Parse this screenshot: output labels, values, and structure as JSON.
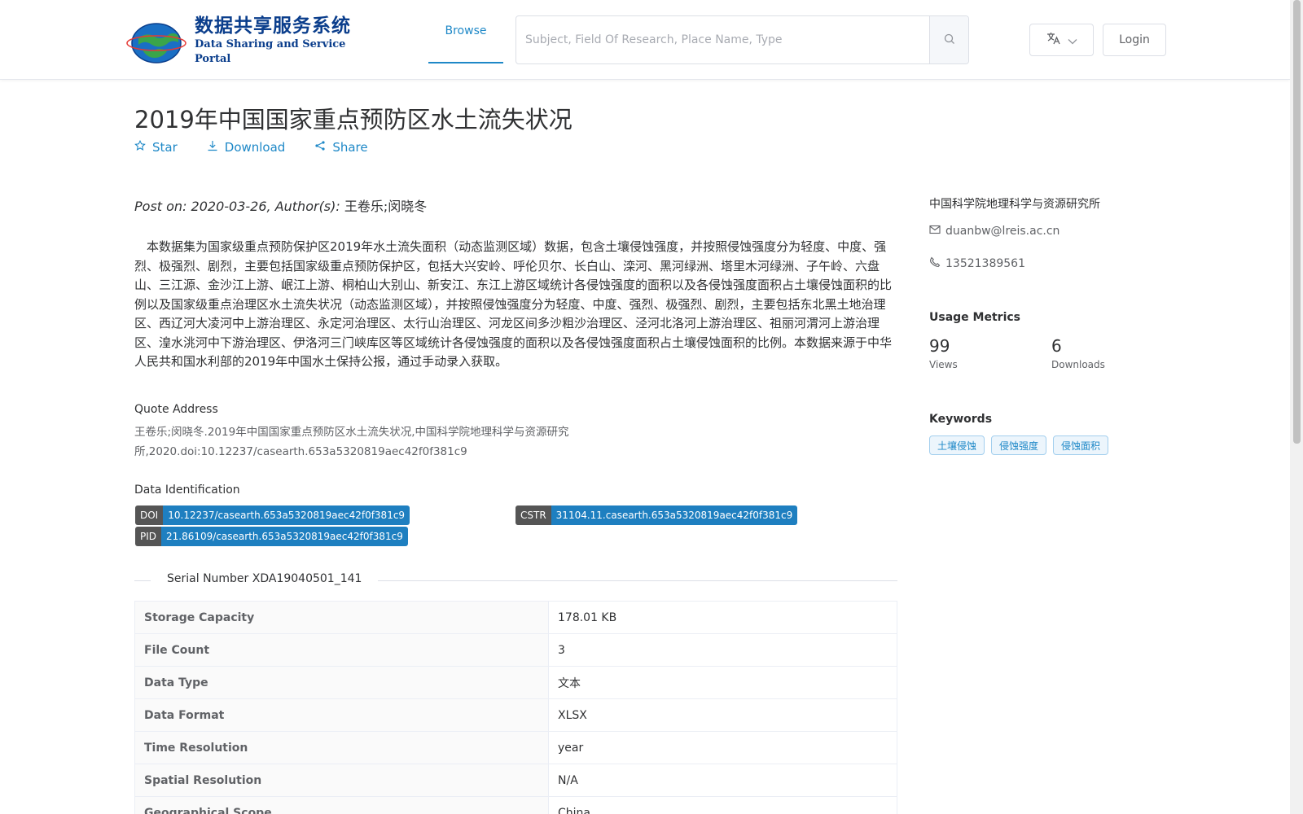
{
  "header": {
    "logo_cn": "数据共享服务系统",
    "logo_en": "Data Sharing and Service Portal",
    "nav_browse": "Browse",
    "search_placeholder": "Subject, Field Of Research, Place Name, Type",
    "login": "Login"
  },
  "dataset": {
    "title": "2019年中国国家重点预防区水土流失状况",
    "actions": {
      "star": "Star",
      "download": "Download",
      "share": "Share"
    },
    "post_on_label": "Post on: 2020-03-26, Author(s): ",
    "authors": "王卷乐;闵晓冬",
    "description": "本数据集为国家级重点预防保护区2019年水土流失面积（动态监测区域）数据，包含土壤侵蚀强度，并按照侵蚀强度分为轻度、中度、强烈、极强烈、剧烈，主要包括国家级重点预防保护区，包括大兴安岭、呼伦贝尔、长白山、滦河、黑河绿洲、塔里木河绿洲、子午岭、六盘山、三江源、金沙江上游、岷江上游、桐柏山大别山、新安江、东江上游区域统计各侵蚀强度的面积以及各侵蚀强度面积占土壤侵蚀面积的比例以及国家级重点治理区水土流失状况（动态监测区域），并按照侵蚀强度分为轻度、中度、强烈、极强烈、剧烈，主要包括东北黑土地治理区、西辽河大凌河中上游治理区、永定河治理区、太行山治理区、河龙区间多沙粗沙治理区、泾河北洛河上游治理区、祖丽河渭河上游治理区、湟水洮河中下游治理区、伊洛河三门峡库区等区域统计各侵蚀强度的面积以及各侵蚀强度面积占土壤侵蚀面积的比例。本数据来源于中华人民共和国水利部的2019年中国水土保持公报，通过手动录入获取。",
    "quote_label": "Quote Address",
    "quote_text": "王卷乐;闵晓冬.2019年中国国家重点预防区水土流失状况,中国科学院地理科学与资源研究所,2020.doi:10.12237/casearth.653a5320819aec42f0f381c9",
    "identification_label": "Data Identification",
    "ids": {
      "doi_key": "DOI",
      "doi_val": "10.12237/casearth.653a5320819aec42f0f381c9",
      "cstr_key": "CSTR",
      "cstr_val": "31104.11.casearth.653a5320819aec42f0f381c9",
      "pid_key": "PID",
      "pid_val": "21.86109/casearth.653a5320819aec42f0f381c9"
    },
    "serial_number": "Serial Number XDA19040501_141",
    "info": [
      {
        "k": "Storage Capacity",
        "v": "178.01 KB"
      },
      {
        "k": "File Count",
        "v": "3"
      },
      {
        "k": "Data Type",
        "v": "文本"
      },
      {
        "k": "Data Format",
        "v": "XLSX"
      },
      {
        "k": "Time Resolution",
        "v": "year"
      },
      {
        "k": "Spatial Resolution",
        "v": "N/A"
      },
      {
        "k": "Geographical Scope",
        "v": "China"
      }
    ]
  },
  "sidebar": {
    "org": "中国科学院地理科学与资源研究所",
    "email": "duanbw@lreis.ac.cn",
    "phone": "13521389561",
    "metrics_heading": "Usage Metrics",
    "views": "99",
    "views_label": "Views",
    "downloads": "6",
    "downloads_label": "Downloads",
    "keywords_heading": "Keywords",
    "keywords": [
      "土壤侵蚀",
      "侵蚀强度",
      "侵蚀面积"
    ]
  },
  "icons": {
    "star": "star-icon",
    "download": "download-icon",
    "share": "share-icon",
    "search": "search-icon",
    "language": "translate-icon",
    "chevron": "chevron-down-icon",
    "email": "mail-icon",
    "phone": "phone-icon"
  },
  "colors": {
    "accent": "#1e88c7",
    "badge_key": "#555555",
    "badge_val": "#1e7fc0",
    "logo": "#0b3e8c"
  }
}
